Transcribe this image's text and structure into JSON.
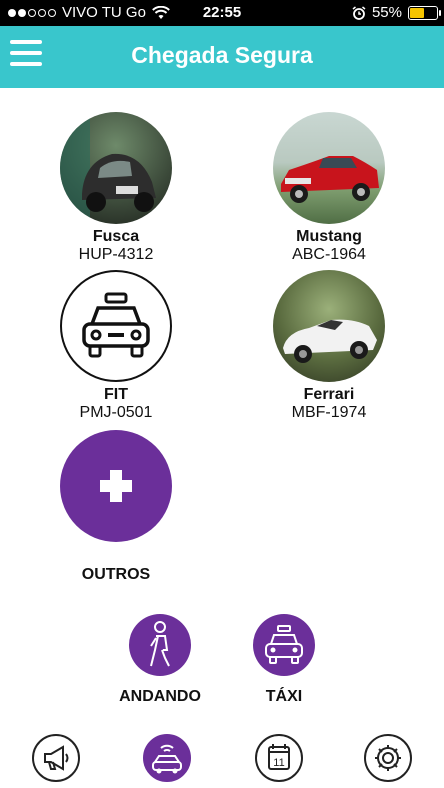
{
  "status_bar": {
    "carrier": "VIVO TU Go",
    "time": "22:55",
    "battery": "55%",
    "battery_level": 0.55
  },
  "app_bar": {
    "title": "Chegada Segura"
  },
  "vehicles": [
    {
      "name": "Fusca",
      "plate": "HUP-4312",
      "image": "vintage-beetle-photo"
    },
    {
      "name": "Mustang",
      "plate": "ABC-1964",
      "image": "red-mustang-photo"
    },
    {
      "name": "FIT",
      "plate": "PMJ-0501",
      "image": "taxi-outline-icon"
    },
    {
      "name": "Ferrari",
      "plate": "MBF-1974",
      "image": "white-ferrari-photo"
    }
  ],
  "add_vehicle": {
    "label": "OUTROS",
    "icon": "plus-icon"
  },
  "modes": [
    {
      "label": "ANDANDO",
      "icon": "walking-person-icon"
    },
    {
      "label": "TÁXI",
      "icon": "taxi-icon"
    }
  ],
  "bottom_nav": {
    "items": [
      "megaphone-icon",
      "car-signal-icon",
      "calendar-icon",
      "gear-icon"
    ],
    "active": "car-signal-icon",
    "calendar_day": "11"
  },
  "colors": {
    "header": "#39c6cc",
    "accent": "#6b2f9a",
    "battery": "#f5c400"
  }
}
